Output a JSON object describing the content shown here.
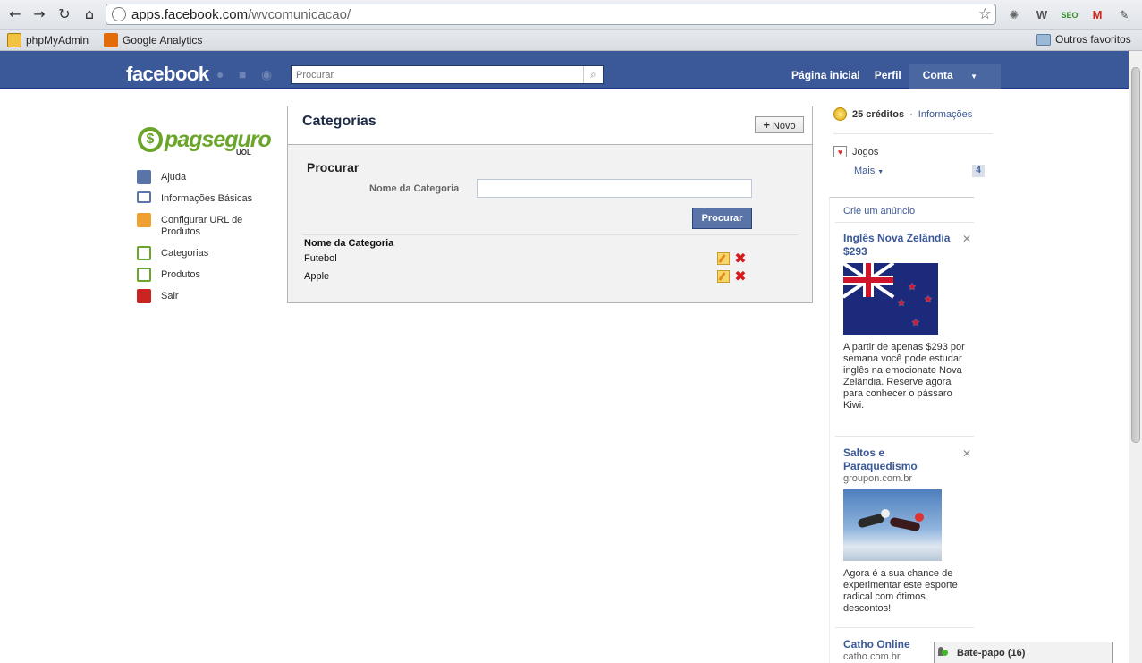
{
  "browser": {
    "url_host": "apps.facebook.com",
    "url_path": "/wvcomunicacao/",
    "bookmarks": [
      {
        "label": "phpMyAdmin",
        "icon": "phpmyadmin-icon"
      },
      {
        "label": "Google Analytics",
        "icon": "analytics-icon"
      }
    ],
    "other_bookmarks": "Outros favoritos"
  },
  "fb": {
    "logo": "facebook",
    "search_placeholder": "Procurar",
    "links": {
      "home": "Página inicial",
      "profile": "Perfil",
      "account": "Conta"
    }
  },
  "app": {
    "logo_text": "pagseguro",
    "logo_sub": "UOL",
    "nav": [
      {
        "label": "Ajuda",
        "icon": "help-icon"
      },
      {
        "label": "Informações Básicas",
        "icon": "info-card-icon"
      },
      {
        "label": "Configurar URL de Produtos",
        "icon": "url-config-icon"
      },
      {
        "label": "Categorias",
        "icon": "categories-icon"
      },
      {
        "label": "Produtos",
        "icon": "products-icon"
      },
      {
        "label": "Sair",
        "icon": "logout-icon"
      }
    ]
  },
  "main": {
    "title": "Categorias",
    "new_button": "Novo",
    "search": {
      "heading": "Procurar",
      "field_label": "Nome da Categoria",
      "field_value": "",
      "button": "Procurar"
    },
    "table": {
      "column": "Nome da Categoria",
      "rows": [
        "Futebol",
        "Apple"
      ]
    }
  },
  "sidebar": {
    "credits_amount": "25 créditos",
    "credits_sep": "·",
    "credits_link": "Informações",
    "games_label": "Jogos",
    "more_label": "Mais",
    "more_count": "4",
    "ads_create": "Crie um anúncio",
    "ads": [
      {
        "title": "Inglês Nova Zelândia $293",
        "domain": "",
        "body": "A partir de apenas $293 por semana você pode estudar inglês na emocionate Nova Zelândia. Reserve agora para conhecer o pássaro Kiwi."
      },
      {
        "title": "Saltos e Paraquedismo",
        "domain": "groupon.com.br",
        "body": "Agora é a sua chance de experimentar este esporte radical com ótimos descontos!"
      },
      {
        "title": "Catho Online",
        "domain": "catho.com.br",
        "body": ""
      }
    ]
  },
  "chat": {
    "label": "Bate-papo",
    "count": "(16)"
  },
  "colors": {
    "fb_blue": "#3b5998",
    "pagseguro_green": "#6aa529",
    "delete_red": "#d81a1a"
  }
}
